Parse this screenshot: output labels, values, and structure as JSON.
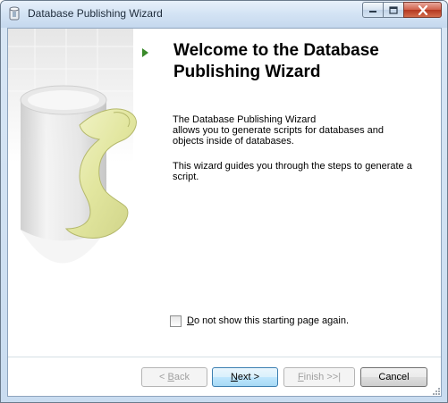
{
  "window": {
    "title": "Database Publishing Wizard"
  },
  "welcome": {
    "heading_line1": "Welcome to the Database",
    "heading_line2": "Publishing Wizard",
    "paragraph1_line1": "The Database Publishing Wizard",
    "paragraph1_line2": "allows you to generate scripts for databases and",
    "paragraph1_line3": "objects inside of databases.",
    "paragraph2_line1": "This wizard guides you through the steps to generate a",
    "paragraph2_line2": "script."
  },
  "options": {
    "dont_show_label_accel": "D",
    "dont_show_label_rest": "o not show this starting page again.",
    "dont_show_checked": false
  },
  "buttons": {
    "back_prefix": "< ",
    "back_accel": "B",
    "back_rest": "ack",
    "next_accel": "N",
    "next_rest": "ext >",
    "finish_accel": "F",
    "finish_rest": "inish >>|",
    "cancel": "Cancel"
  },
  "icons": {
    "title_icon": "database-icon",
    "play_icon": "play-arrow-icon",
    "minimize": "minimize-icon",
    "maximize": "maximize-icon",
    "close": "close-icon"
  },
  "colors": {
    "accent_green": "#3a8a2a",
    "close_red": "#c5452e",
    "scroll_yellow": "#e8ecae"
  }
}
